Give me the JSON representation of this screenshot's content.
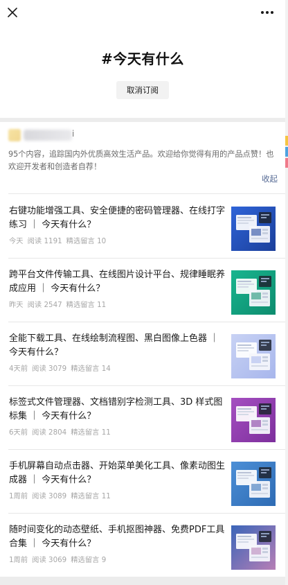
{
  "topbar": {
    "close_icon": "close-icon",
    "more_icon": "more-icon"
  },
  "header": {
    "title": "#今天有什么",
    "unsubscribe_label": "取消订阅"
  },
  "intro": {
    "name_tail": "i",
    "description": "95个内容，追踪国内外优质高效生活产品。欢迎给你觉得有用的产品点赞！也欢迎开发者和创造者自荐！",
    "collapse_label": "收起"
  },
  "articles": [
    {
      "title": "右键功能增强工具、安全便捷的密码管理器、在线打字练习 ｜ 今天有什么？",
      "date": "今天",
      "reads": "阅读 1191",
      "comments": "精选留言 10",
      "thumb_colors": [
        "#2f64d8",
        "#1b3f9a"
      ]
    },
    {
      "title": "跨平台文件传输工具、在线图片设计平台、规律睡眠养成应用 ｜ 今天有什么？",
      "date": "昨天",
      "reads": "阅读 2547",
      "comments": "精选留言 11",
      "thumb_colors": [
        "#18b58f",
        "#0e8c6e"
      ]
    },
    {
      "title": "全能下载工具、在线绘制流程图、黑白图像上色器 ｜ 今天有什么？",
      "date": "4天前",
      "reads": "阅读 3079",
      "comments": "精选留言 14",
      "thumb_colors": [
        "#c8d2f4",
        "#a7b6ec"
      ]
    },
    {
      "title": "标签式文件管理器、文档错别字检测工具、3D 样式图标集 ｜ 今天有什么？",
      "date": "6天前",
      "reads": "阅读 2804",
      "comments": "精选留言 11",
      "thumb_colors": [
        "#a54fc1",
        "#7d2f9c"
      ]
    },
    {
      "title": "手机屏幕自动点击器、开始菜单美化工具、像素动图生成器 ｜ 今天有什么？",
      "date": "1周前",
      "reads": "阅读 3089",
      "comments": "精选留言 11",
      "thumb_colors": [
        "#4c8fd6",
        "#2e6bb4"
      ]
    },
    {
      "title": "随时间变化的动态壁纸、手机抠图神器、免费PDF工具合集 ｜ 今天有什么？",
      "date": "1周前",
      "reads": "阅读 3069",
      "comments": "精选留言 9",
      "thumb_colors": [
        "#3a65b8",
        "#b77fb6"
      ]
    }
  ],
  "colors": {
    "accent_link": "#576b95",
    "meta_text": "#a6a6a6",
    "title_text": "#1a1a1a"
  }
}
